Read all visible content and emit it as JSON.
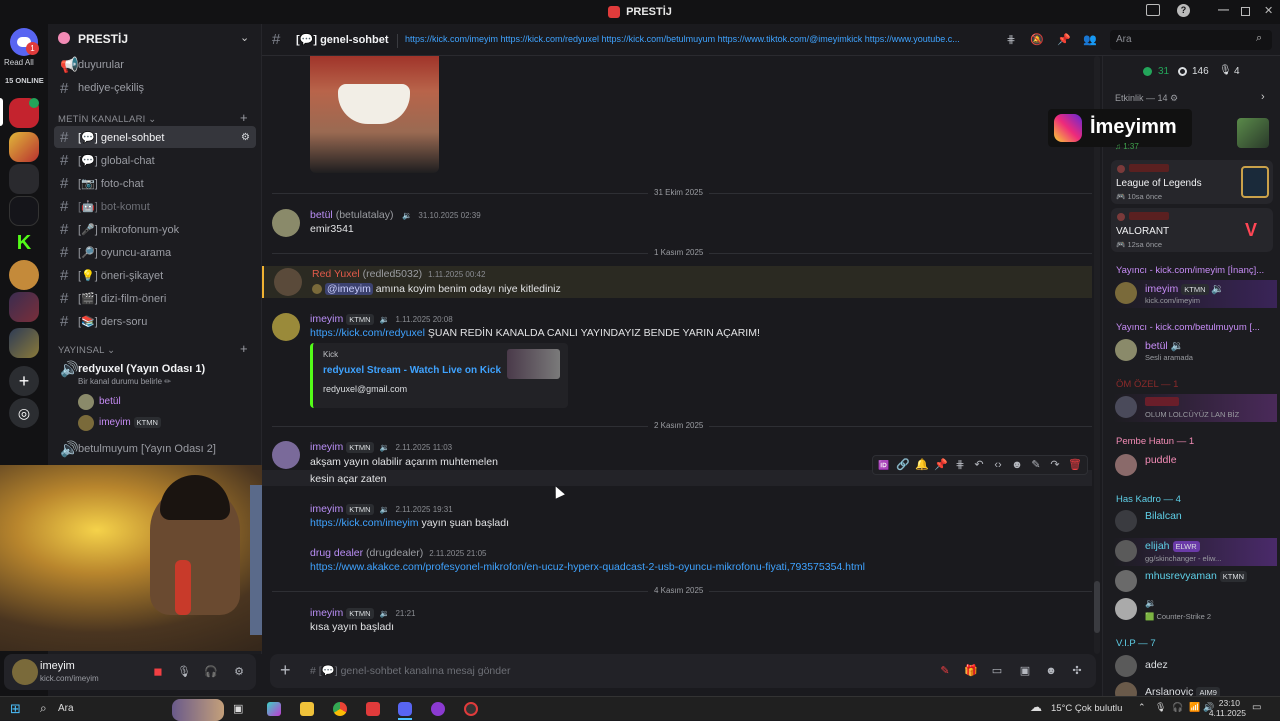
{
  "window": {
    "title": "PRESTİJ"
  },
  "rail": {
    "read_all": "Read All",
    "online": "15 ONLINE",
    "badge": "1"
  },
  "server": {
    "name": "PRESTİJ"
  },
  "channels": {
    "top": [
      {
        "label": "duyurular"
      },
      {
        "label": "hediye-çekiliş"
      }
    ],
    "metin_category": "METİN KANALLARI",
    "metin": [
      {
        "label": "[💬] genel-sohbet"
      },
      {
        "label": "[💬] global-chat"
      },
      {
        "label": "[📷] foto-chat"
      },
      {
        "label": "[🤖] bot-komut"
      },
      {
        "label": "[🎤] mikrofonum-yok"
      },
      {
        "label": "[🔎] oyuncu-arama"
      },
      {
        "label": "[💡] öneri-şikayet"
      },
      {
        "label": "[🎬] dizi-film-öneri"
      },
      {
        "label": "[📚] ders-soru"
      }
    ],
    "yayinsal_category": "YAYINSAL",
    "voice1": {
      "label": "redyuxel (Yayın Odası 1)",
      "status": "Bir kanal durumu belirle ✏",
      "users": [
        {
          "name": "betül"
        },
        {
          "name": "imeyim",
          "badge": "KTMN"
        }
      ]
    },
    "voice2": {
      "label": "betulmuyum [Yayın Odası 2]"
    }
  },
  "user_panel": {
    "name": "imeyim",
    "status": "kick.com/imeyim"
  },
  "header": {
    "channel": "[💬] genel-sohbet",
    "topic": "https://kick.com/imeyim https://kick.com/redyuxel https://kick.com/betulmuyum https://www.tiktok.com/@imeyimkick https://www.youtube.c...",
    "search_placeholder": "Ara"
  },
  "chat": {
    "dividers": [
      "31 Ekim 2025",
      "1 Kasım 2025",
      "2 Kasım 2025",
      "4 Kasım 2025"
    ],
    "messages": [
      {
        "user": "betül",
        "tag": "(betulatalay)",
        "time": "31.10.2025 02:39",
        "text": "emir3541"
      },
      {
        "user": "Red Yuxel",
        "tag": "(redled5032)",
        "time": "1.11.2025 00:42",
        "mention": "@imeyim",
        "text": "amına koyim benim odayı niye kitlediniz"
      },
      {
        "user": "imeyim",
        "badge": "KTMN",
        "time": "1.11.2025 20:08",
        "link": "https://kick.com/redyuxel",
        "text": "ŞUAN REDİN KANALDA CANLI YAYINDAYIZ BENDE YARIN AÇARIM!",
        "embed": {
          "provider": "Kick",
          "title": "redyuxel Stream - Watch Live on Kick",
          "desc": "redyuxel@gmail.com"
        }
      },
      {
        "user": "imeyim",
        "badge": "KTMN",
        "time": "2.11.2025 11:03",
        "text": "akşam yayın olabilir açarım muhtemelen",
        "text2": "kesin açar zaten"
      },
      {
        "user": "imeyim",
        "badge": "KTMN",
        "time": "2.11.2025 19:31",
        "link": "https://kick.com/imeyim",
        "text": "yayın şuan başladı"
      },
      {
        "user": "drug dealer",
        "tag": "(drugdealer)",
        "time": "2.11.2025 21:05",
        "link": "https://www.akakce.com/profesyonel-mikrofon/en-ucuz-hyperx-quadcast-2-usb-oyuncu-mikrofonu-fiyati,793575354.html"
      },
      {
        "user": "imeyim",
        "badge": "KTMN",
        "time": "21:21",
        "text": "kısa yayın başladı"
      }
    ]
  },
  "composer": {
    "placeholder": "# [💬] genel-sohbet kanalına mesaj gönder"
  },
  "members": {
    "counts": {
      "online": "31",
      "idle": "146",
      "voice": "4"
    },
    "activity": "Etkinlik — 14",
    "overlay_name": "İmeyimm",
    "activity_cards": [
      {
        "time": "1:37"
      },
      {
        "game": "League of Legends",
        "ago": "10sa önce"
      },
      {
        "game": "VALORANT",
        "ago": "12sa önce"
      }
    ],
    "groups": [
      {
        "title": "Yayıncı - kick.com/imeyim [İnanç]...",
        "color": "#c68cf5",
        "items": [
          {
            "name": "imeyim",
            "badge": "KTMN",
            "sub": "kick.com/imeyim",
            "color": "#c68cf5"
          }
        ]
      },
      {
        "title": "Yayıncı - kick.com/betulmuyum [...",
        "color": "#c68cf5",
        "items": [
          {
            "name": "betül",
            "sub": "Sesli aramada",
            "color": "#c68cf5"
          }
        ]
      },
      {
        "title": "Pembe Hatun — 1",
        "color": "#f28bb5",
        "items": [
          {
            "name": "puddle",
            "sub": "",
            "color": "#f28bb5"
          }
        ]
      },
      {
        "title": "Has Kadro — 4",
        "color": "#5fd0e8",
        "items": [
          {
            "name": "Bilalcan",
            "sub": "",
            "color": "#5fd0e8"
          },
          {
            "name": "elijah",
            "badge": "ELWR",
            "sub": "gg/skinchanger - eliw...",
            "color": "#5fd0e8"
          },
          {
            "name": "mhusrevyaman",
            "badge": "KTMN",
            "sub": "",
            "color": "#5fd0e8"
          },
          {
            "name": "",
            "sub": "Counter-Strike 2",
            "color": "#5fd0e8"
          }
        ]
      },
      {
        "title": "V.I.P — 7",
        "color": "#5fd0e8",
        "items": [
          {
            "name": "adez",
            "sub": "",
            "color": "#dbdee1"
          },
          {
            "name": "Arslanoviç",
            "badge": "AIM9",
            "sub": "",
            "color": "#dbdee1"
          }
        ]
      }
    ],
    "hidden_group": {
      "title": "ÖM ÖZEL — 1",
      "sub": "OLUM LOLCÜYÜZ LAN BİZ"
    }
  },
  "taskbar": {
    "search": "Ara",
    "weather": "15°C  Çok bulutlu",
    "time": "23:10",
    "date": "4.11.2025"
  },
  "colors": {
    "accent": "#5865f2",
    "link": "#3fa3ff",
    "name_purple": "#b98ef5",
    "danger": "#e03b3b",
    "online": "#23a55a"
  }
}
